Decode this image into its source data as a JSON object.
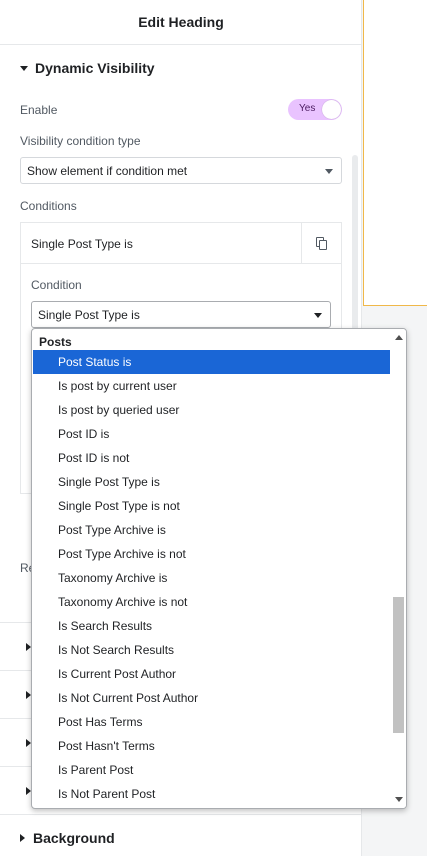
{
  "header": {
    "title": "Edit Heading"
  },
  "dynamic_visibility": {
    "section_title": "Dynamic Visibility",
    "enable_label": "Enable",
    "enable_value": "Yes",
    "type_label": "Visibility condition type",
    "type_value": "Show element if condition met",
    "conditions_label": "Conditions",
    "item_title": "Single Post Type is",
    "condition_label": "Condition",
    "condition_value": "Single Post Type is",
    "partial_label": "Re"
  },
  "background_section": {
    "title": "Background"
  },
  "dropdown": {
    "group": "Posts",
    "options": [
      "Post Status is",
      "Is post by current user",
      "Is post by queried user",
      "Post ID is",
      "Post ID is not",
      "Single Post Type is",
      "Single Post Type is not",
      "Post Type Archive is",
      "Post Type Archive is not",
      "Taxonomy Archive is",
      "Taxonomy Archive is not",
      "Is Search Results",
      "Is Not Search Results",
      "Is Current Post Author",
      "Is Not Current Post Author",
      "Post Has Terms",
      "Post Hasn't Terms",
      "Is Parent Post",
      "Is Not Parent Post"
    ],
    "highlighted": "Post Status is"
  },
  "colors": {
    "toggle_on": "#e9c3ff",
    "highlight": "#1a66d6",
    "preview_border": "#f0b849"
  }
}
